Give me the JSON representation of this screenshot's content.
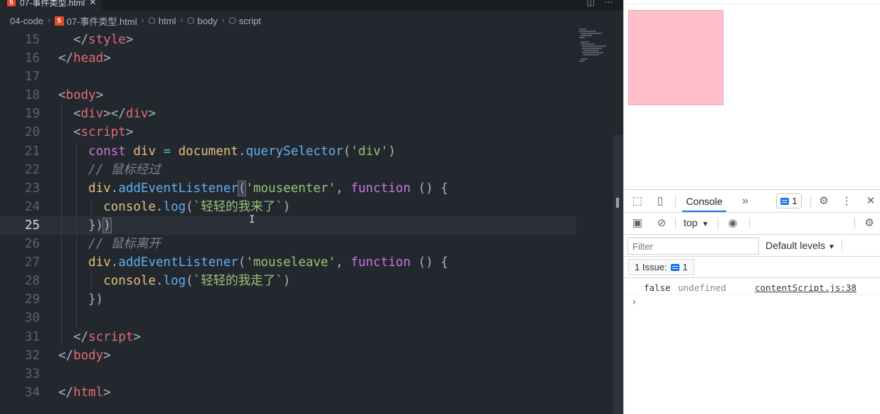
{
  "editor": {
    "tab": {
      "filename": "07-事件类型.html",
      "close": "✕"
    },
    "breadcrumb": [
      "04-code",
      "07-事件类型.html",
      "html",
      "body",
      "script"
    ],
    "lines": [
      {
        "n": "15",
        "html": "  <span class=\"t-punc\">&lt;/</span><span class=\"t-tag\">style</span><span class=\"t-punc\">&gt;</span>"
      },
      {
        "n": "16",
        "html": "<span class=\"t-punc\">&lt;/</span><span class=\"t-tag\">head</span><span class=\"t-punc\">&gt;</span>"
      },
      {
        "n": "17",
        "html": ""
      },
      {
        "n": "18",
        "html": "<span class=\"t-punc\">&lt;</span><span class=\"t-tag\">body</span><span class=\"t-punc\">&gt;</span>"
      },
      {
        "n": "19",
        "html": "  <span class=\"t-punc\">&lt;</span><span class=\"t-tag\">div</span><span class=\"t-punc\">&gt;&lt;/</span><span class=\"t-tag\">div</span><span class=\"t-punc\">&gt;</span>"
      },
      {
        "n": "20",
        "html": "  <span class=\"t-punc\">&lt;</span><span class=\"t-tag\">script</span><span class=\"t-punc\">&gt;</span>"
      },
      {
        "n": "21",
        "html": "    <span class=\"t-kw\">const</span> <span class=\"t-var\">div</span> <span class=\"t-op\">=</span> <span class=\"t-var\">document</span>.<span class=\"t-fn\">querySelector</span>(<span class=\"t-str\">'div'</span>)"
      },
      {
        "n": "22",
        "html": "    <span class=\"t-com\">// 鼠标经过</span>"
      },
      {
        "n": "23",
        "html": "    <span class=\"t-var\">div</span>.<span class=\"t-fn\">addEventListener</span><span class=\"bracket-hl\">(</span><span class=\"t-str\">'mouseenter'</span>, <span class=\"t-kw\">function</span> () {"
      },
      {
        "n": "24",
        "html": "      <span class=\"t-var\">console</span>.<span class=\"t-fn\">log</span>(<span class=\"t-str\">`轻轻的我来了`</span>)"
      },
      {
        "n": "25",
        "html": "    })<span class=\"bracket-hl\">)</span>",
        "current": true
      },
      {
        "n": "26",
        "html": "    <span class=\"t-com\">// 鼠标离开</span>"
      },
      {
        "n": "27",
        "html": "    <span class=\"t-var\">div</span>.<span class=\"t-fn\">addEventListener</span>(<span class=\"t-str\">'mouseleave'</span>, <span class=\"t-kw\">function</span> () {"
      },
      {
        "n": "28",
        "html": "      <span class=\"t-var\">console</span>.<span class=\"t-fn\">log</span>(<span class=\"t-str\">`轻轻的我走了`</span>)"
      },
      {
        "n": "29",
        "html": "    })"
      },
      {
        "n": "30",
        "html": ""
      },
      {
        "n": "31",
        "html": "  <span class=\"t-punc\">&lt;/</span><span class=\"t-tag\">script</span><span class=\"t-punc\">&gt;</span>"
      },
      {
        "n": "32",
        "html": "<span class=\"t-punc\">&lt;/</span><span class=\"t-tag\">body</span><span class=\"t-punc\">&gt;</span>"
      },
      {
        "n": "33",
        "html": ""
      },
      {
        "n": "34",
        "html": "<span class=\"t-punc\">&lt;/</span><span class=\"t-tag\">html</span><span class=\"t-punc\">&gt;</span>"
      }
    ]
  },
  "browser": {
    "box_color": "#ffc0cb"
  },
  "devtools": {
    "tab_console": "Console",
    "tab_more": "»",
    "issues_count": "1",
    "context": "top",
    "filter_placeholder": "Filter",
    "levels": "Default levels",
    "issues_label": "1 Issue:",
    "issues_pill_count": "1",
    "log": {
      "value": "false",
      "extra": "undefined",
      "source": "contentScript.js:38"
    },
    "prompt": "›"
  }
}
